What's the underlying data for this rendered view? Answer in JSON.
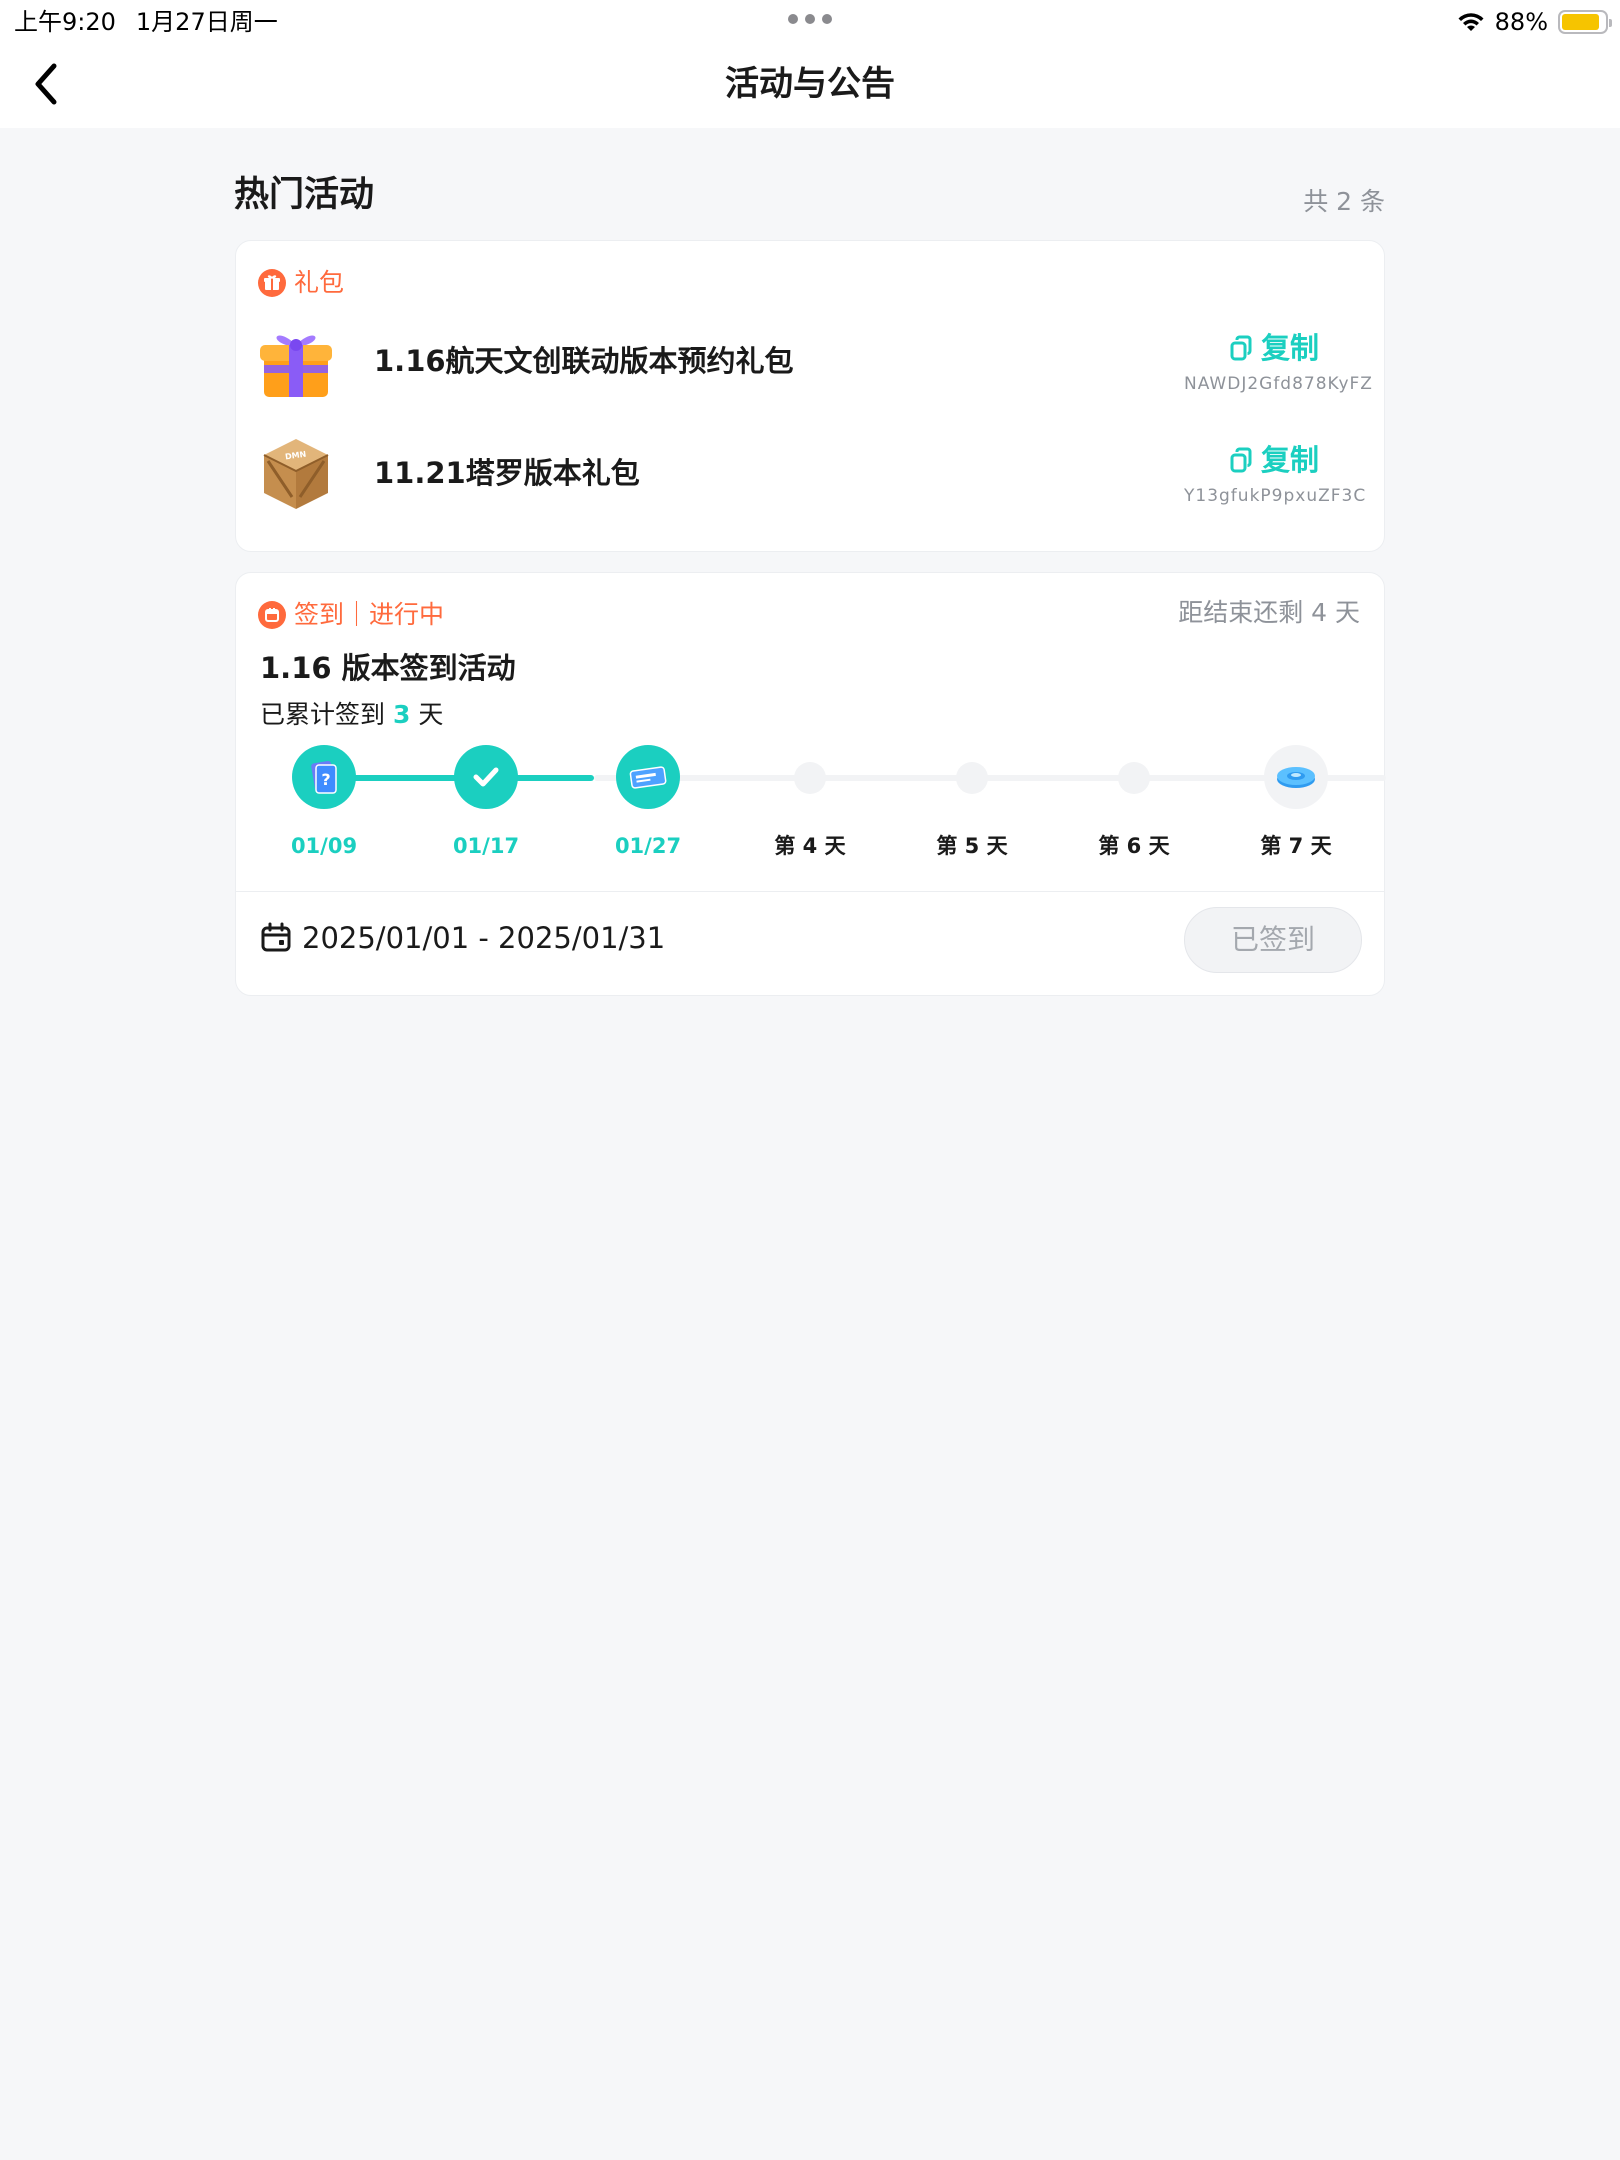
{
  "status_bar": {
    "time": "上午9:20",
    "date": "1月27日周一",
    "battery": "88%",
    "battery_level": 0.88
  },
  "nav": {
    "title": "活动与公告"
  },
  "section": {
    "title": "热门活动",
    "count": "共 2 条"
  },
  "gift_card": {
    "tag": "礼包",
    "items": [
      {
        "name": "1.16航天文创联动版本预约礼包",
        "copy_label": "复制",
        "code": "NAWDJ2Gfd878KyFZ",
        "thumb": "purple-gift-box-icon"
      },
      {
        "name": "11.21塔罗版本礼包",
        "copy_label": "复制",
        "code": "Y13gfukP9pxuZF3C",
        "thumb": "wooden-crate-icon"
      }
    ]
  },
  "sign_card": {
    "tag": "签到｜进行中",
    "remaining": "距结束还剩 4 天",
    "title": "1.16 版本签到活动",
    "count_prefix": "已累计签到",
    "count_value": "3",
    "count_suffix": "天",
    "days": [
      {
        "label": "01/09",
        "state": "done",
        "icon": "mystery-card-icon"
      },
      {
        "label": "01/17",
        "state": "done",
        "icon": "check-icon"
      },
      {
        "label": "01/27",
        "state": "done",
        "icon": "ticket-icon"
      },
      {
        "label": "第 4 天",
        "state": "pending"
      },
      {
        "label": "第 5 天",
        "state": "pending"
      },
      {
        "label": "第 6 天",
        "state": "pending"
      },
      {
        "label": "第 7 天",
        "state": "reward",
        "icon": "blue-disc-icon"
      }
    ],
    "date_range": "2025/01/01 - 2025/01/31",
    "button_label": "已签到"
  },
  "colors": {
    "accent": "#1bcfc0",
    "tag": "#ff6a3d",
    "background": "#f6f7f9"
  }
}
